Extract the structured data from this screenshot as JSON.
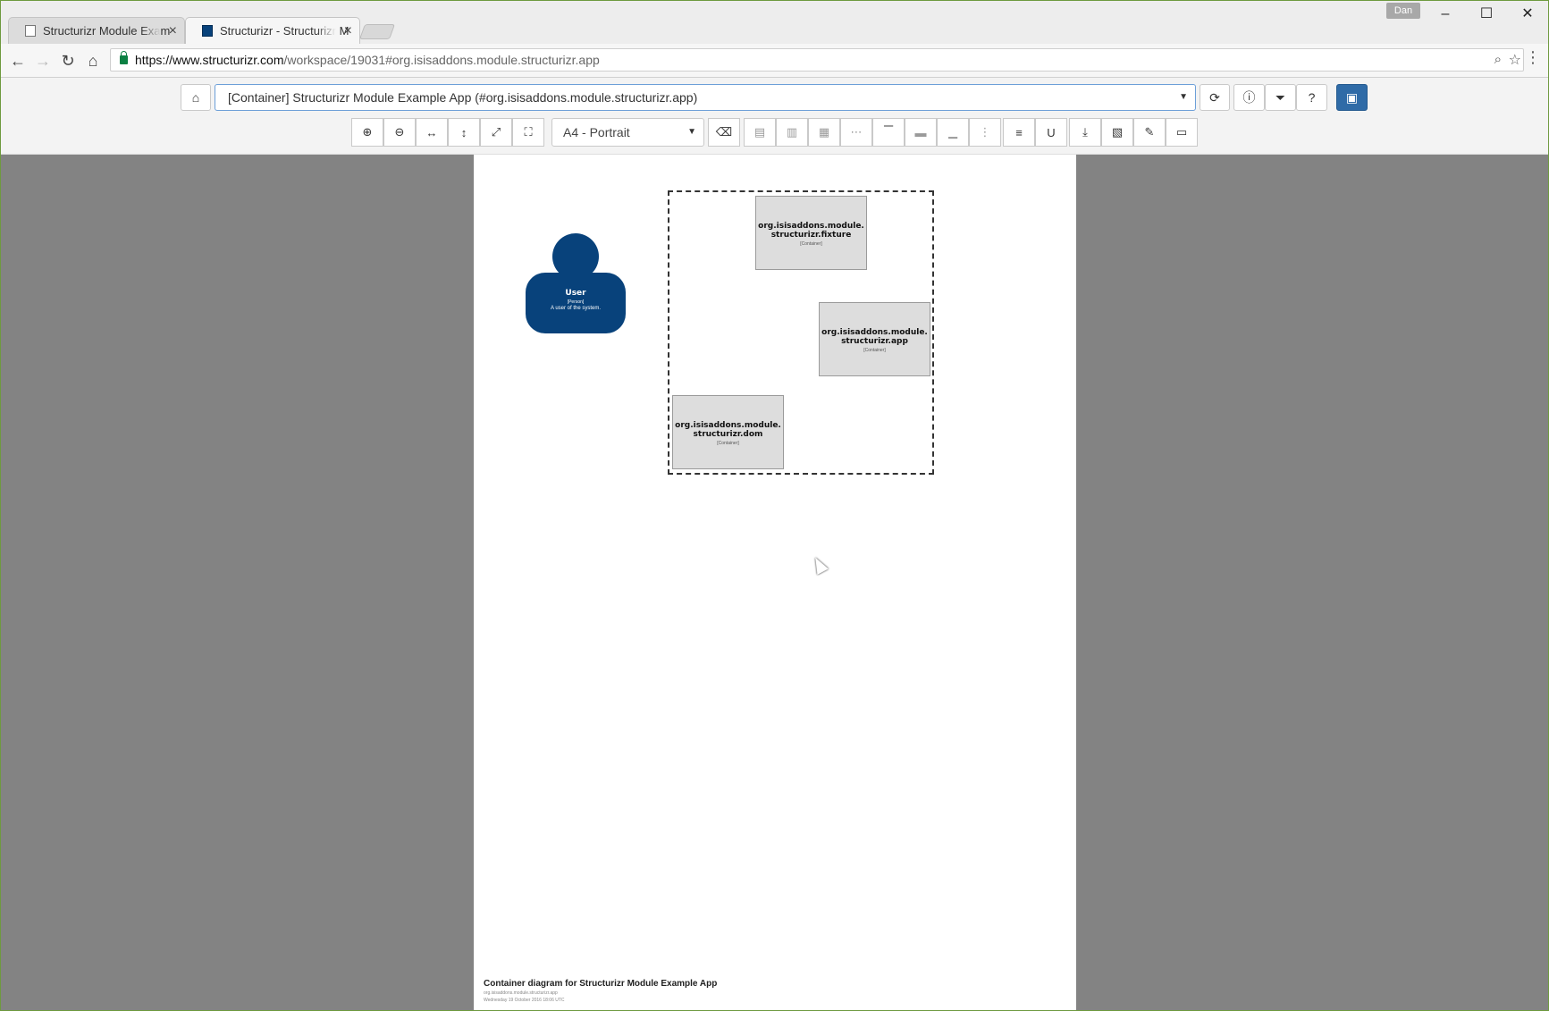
{
  "browser": {
    "tabs": [
      {
        "title": "Structurizr Module Exam",
        "active": false
      },
      {
        "title": "Structurizr - Structurizr M",
        "active": true
      }
    ],
    "user": "Dan",
    "url_host": "https://www.structurizr.com",
    "url_path": "/workspace/19031#org.isisaddons.module.structurizr.app",
    "icons": {
      "back": "arrow-left-icon",
      "forward": "arrow-right-icon",
      "reload": "reload-icon",
      "home": "home-icon",
      "zoom": "magnifier-icon",
      "bookmark": "star-icon",
      "menu": "kebab-menu-icon"
    }
  },
  "toolbar": {
    "view_selected": "[Container] Structurizr Module Example App (#org.isisaddons.module.structurizr.app)",
    "paper_size": "A4 - Portrait",
    "colors": {
      "primary": "#2f6ba7",
      "select_border": "#6c9fd8"
    }
  },
  "diagram": {
    "person": {
      "name": "User",
      "type": "[Person]",
      "description": "A user of the system.",
      "color": "#08427b"
    },
    "containers": [
      {
        "name": "org.isisaddons.module.structurizr.fixture",
        "type": "[Container]"
      },
      {
        "name": "org.isisaddons.module.structurizr.app",
        "type": "[Container]"
      },
      {
        "name": "org.isisaddons.module.structurizr.dom",
        "type": "[Container]"
      }
    ],
    "title": "Container diagram for Structurizr Module Example App",
    "key": "org.isisaddons.module.structurizr.app",
    "date": "Wednesday 19 October 2016 18:06 UTC"
  }
}
